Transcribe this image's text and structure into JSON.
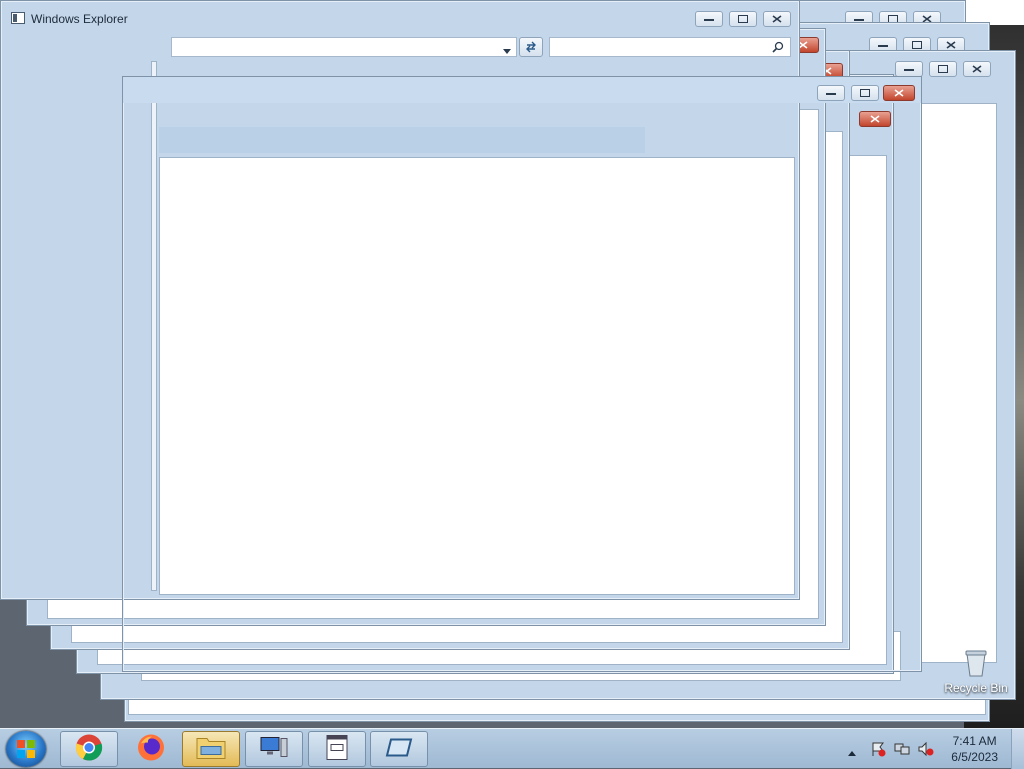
{
  "explorer": {
    "title": "Windows Explorer"
  },
  "desktop": {
    "recycle_bin_label": "Recycle Bin"
  },
  "taskbar": {
    "pinned": [
      {
        "name": "chrome",
        "icon": "chrome-icon",
        "active": false
      },
      {
        "name": "firefox",
        "icon": "firefox-icon",
        "active": false
      },
      {
        "name": "file-explorer",
        "icon": "folder-icon",
        "active": true
      },
      {
        "name": "computer",
        "icon": "computer-icon",
        "active": false
      },
      {
        "name": "notepad",
        "icon": "document-icon",
        "active": false
      },
      {
        "name": "app-window",
        "icon": "window-icon",
        "active": false
      }
    ],
    "clock": {
      "time": "7:41 AM",
      "date": "6/5/2023"
    }
  },
  "colors": {
    "frame": "#c3d6ea",
    "close_button": "#c2452d",
    "taskbar": "#a9c2da"
  }
}
